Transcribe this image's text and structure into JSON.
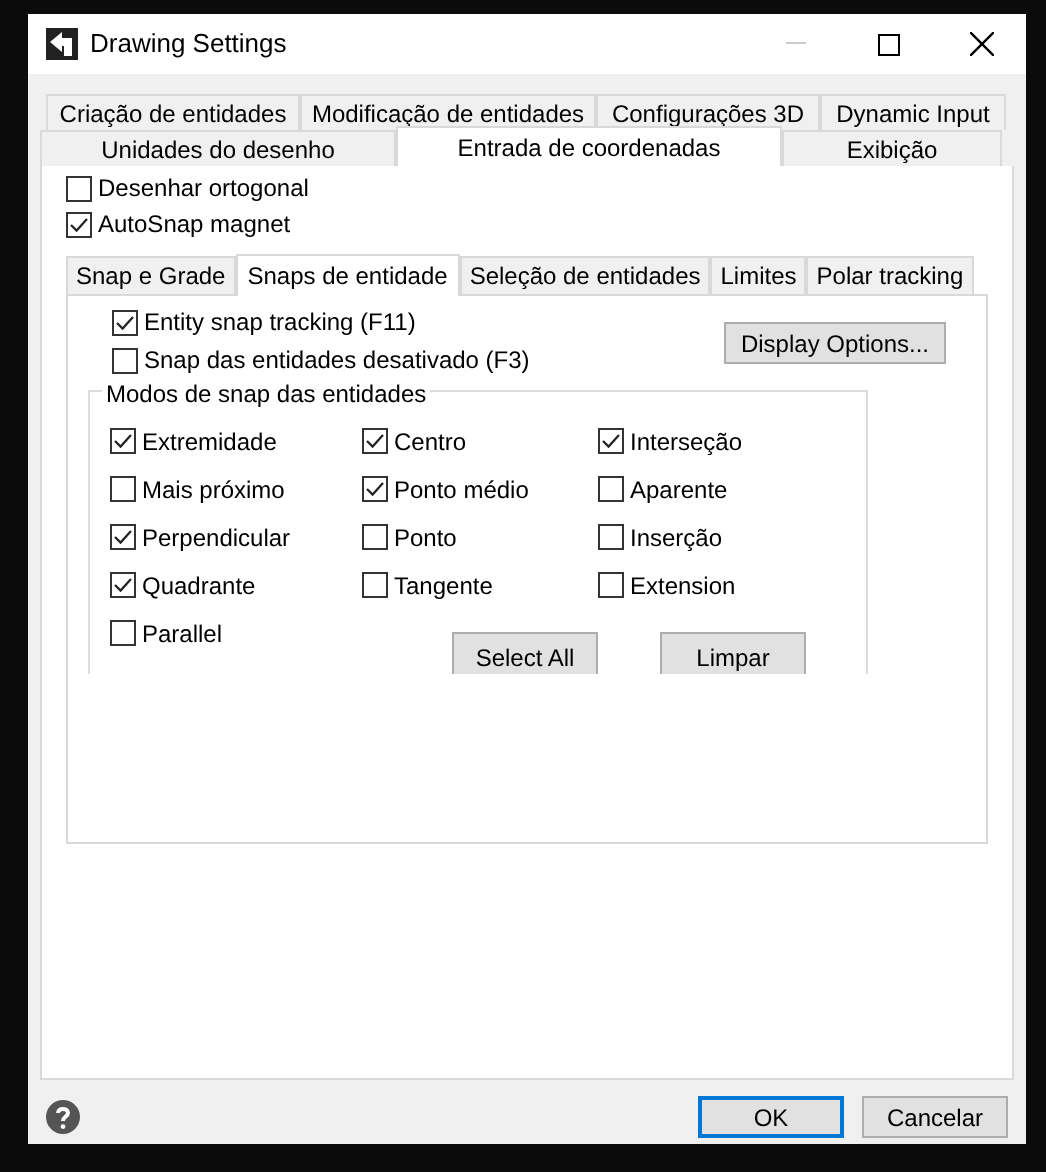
{
  "window": {
    "title": "Drawing Settings"
  },
  "main_tabs": [
    [
      {
        "label": "Criação de entidades",
        "selected": false
      },
      {
        "label": "Modificação de entidades",
        "selected": false
      },
      {
        "label": "Configurações 3D",
        "selected": false
      },
      {
        "label": "Dynamic Input",
        "selected": false
      }
    ],
    [
      {
        "label": "Unidades do desenho",
        "selected": false
      },
      {
        "label": "Entrada de coordenadas",
        "selected": true
      },
      {
        "label": "Exibição",
        "selected": false
      }
    ]
  ],
  "options": [
    {
      "label": "Desenhar ortogonal",
      "checked": false
    },
    {
      "label": "AutoSnap magnet",
      "checked": true
    }
  ],
  "sub_tabs": [
    {
      "label": "Snap e Grade",
      "selected": false
    },
    {
      "label": "Snaps de entidade",
      "selected": true
    },
    {
      "label": "Seleção de entidades",
      "selected": false
    },
    {
      "label": "Limites",
      "selected": false
    },
    {
      "label": "Polar tracking",
      "selected": false
    }
  ],
  "snap_options": [
    {
      "label": "Entity snap tracking (F11)",
      "checked": true
    },
    {
      "label": "Snap das entidades desativado (F3)",
      "checked": false
    }
  ],
  "display_options_button": "Display Options...",
  "modes_group": {
    "title": "Modos de snap das entidades",
    "modes": [
      {
        "label": "Extremidade",
        "checked": true
      },
      {
        "label": "Centro",
        "checked": true
      },
      {
        "label": "Interseção",
        "checked": true
      },
      {
        "label": "Mais próximo",
        "checked": false
      },
      {
        "label": "Ponto médio",
        "checked": true
      },
      {
        "label": "Aparente",
        "checked": false
      },
      {
        "label": "Perpendicular",
        "checked": true
      },
      {
        "label": "Ponto",
        "checked": false
      },
      {
        "label": "Inserção",
        "checked": false
      },
      {
        "label": "Quadrante",
        "checked": true
      },
      {
        "label": "Tangente",
        "checked": false
      },
      {
        "label": "Extension",
        "checked": false
      },
      {
        "label": "Parallel",
        "checked": false
      }
    ],
    "buttons": [
      "Select All",
      "Limpar"
    ]
  },
  "footer_buttons": [
    {
      "label": "OK",
      "default": true
    },
    {
      "label": "Cancelar",
      "default": false
    }
  ]
}
